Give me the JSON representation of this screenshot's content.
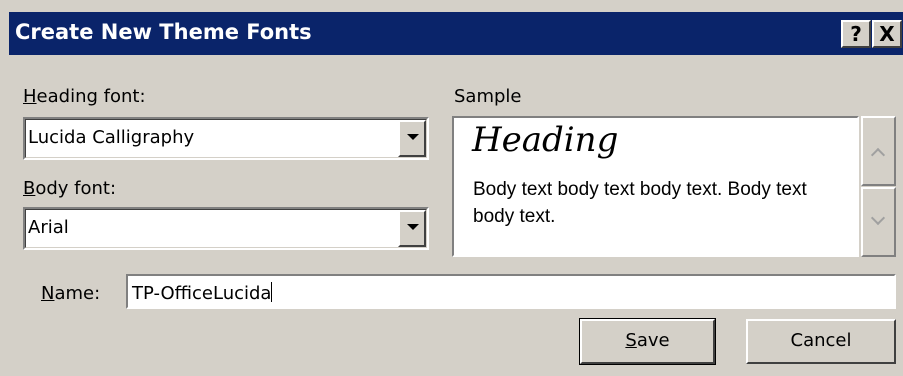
{
  "dialog": {
    "title": "Create New Theme Fonts",
    "help_label": "?",
    "close_label": "X"
  },
  "heading_font": {
    "label_mnemonic": "H",
    "label_rest": "eading font:",
    "value": "Lucida Calligraphy"
  },
  "body_font": {
    "label_mnemonic": "B",
    "label_rest": "ody font:",
    "value": "Arial"
  },
  "sample": {
    "label": "Sample",
    "heading_text": "Heading",
    "body_text": "Body text body text body text. Body text body text."
  },
  "name": {
    "label_mnemonic": "N",
    "label_rest": "ame:",
    "value": "TP-OfficeLucida"
  },
  "buttons": {
    "save_mnemonic": "S",
    "save_rest": "ave",
    "cancel": "Cancel"
  },
  "colors": {
    "titlebar": "#0a246a",
    "dialog_bg": "#d4d0c8"
  }
}
